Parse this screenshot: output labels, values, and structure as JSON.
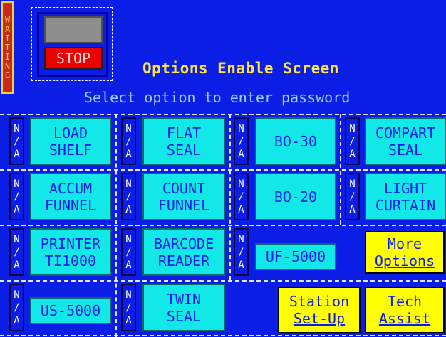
{
  "status": {
    "waiting": [
      "W",
      "A",
      "I",
      "T",
      "I",
      "N",
      "G"
    ]
  },
  "stop": {
    "label": "STOP"
  },
  "header": {
    "title": "Options Enable Screen",
    "subtitle": "Select option to enter password"
  },
  "na_label": [
    "N",
    "/",
    "A"
  ],
  "options": [
    {
      "lines": [
        "LOAD",
        "SHELF"
      ]
    },
    {
      "lines": [
        "FLAT",
        "SEAL"
      ]
    },
    {
      "lines": [
        "BO-30"
      ]
    },
    {
      "lines": [
        "COMPART",
        "SEAL"
      ]
    },
    {
      "lines": [
        "ACCUM",
        "FUNNEL"
      ]
    },
    {
      "lines": [
        "COUNT",
        "FUNNEL"
      ]
    },
    {
      "lines": [
        "BO-20"
      ]
    },
    {
      "lines": [
        "LIGHT",
        "CURTAIN"
      ]
    },
    {
      "lines": [
        "PRINTER",
        "TI1000"
      ]
    },
    {
      "lines": [
        "BARCODE",
        "READER"
      ]
    },
    {
      "lines": [
        "UF-5000"
      ]
    },
    {
      "lines": [
        "US-5000"
      ]
    },
    {
      "lines": [
        "TWIN",
        "SEAL"
      ]
    }
  ],
  "buttons": {
    "more_options": [
      "More",
      "Options"
    ],
    "station_setup": [
      "Station",
      "Set-Up"
    ],
    "tech_assist": [
      "Tech",
      "Assist"
    ]
  },
  "colors": {
    "background": "#0a1ee6",
    "option": "#12e8e8",
    "action": "#ffff00",
    "stop": "#ea0000",
    "title": "#ffe24a"
  }
}
